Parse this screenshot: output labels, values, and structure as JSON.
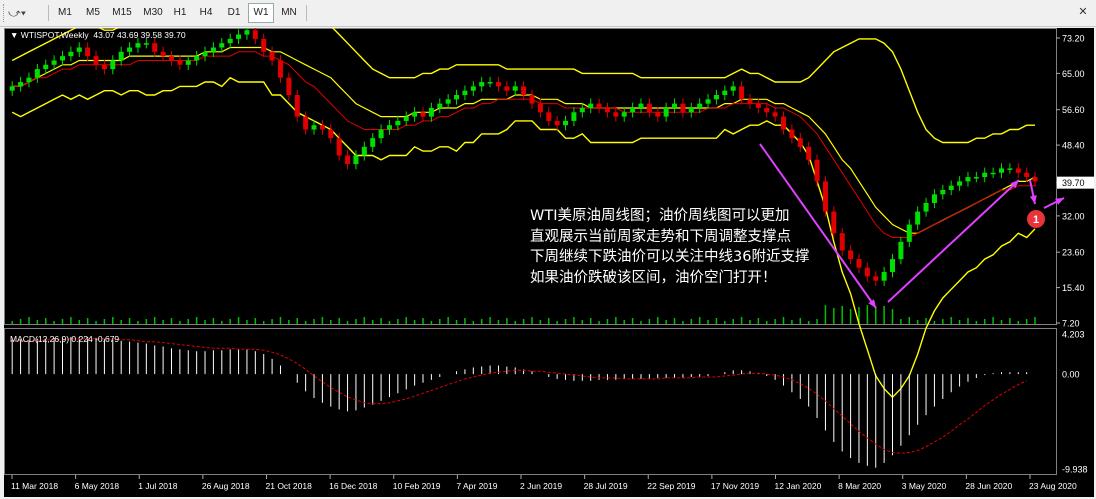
{
  "toolbar": {
    "timeframes": [
      "M1",
      "M5",
      "M15",
      "M30",
      "H1",
      "H4",
      "D1",
      "W1",
      "MN"
    ],
    "active": "W1",
    "close_icon": "close-icon",
    "tools_icon": "line-tools-icon"
  },
  "header": {
    "symbol": "WTISPOT,Weekly",
    "ohlc": "43.07 43.69 39.58 39.70"
  },
  "macd_header": "MACD(12,26,9) 0.224 -0.679",
  "annotation": {
    "lines": [
      "WTI美原油周线图；油价周线图可以更加",
      "直观展示当前周家走势和下周调整支撑点",
      "下周继续下跌油价可以关注中线36附近支撑",
      "如果油价跌破该区间，油价空门打开！"
    ],
    "badge": "1"
  },
  "colors": {
    "up": "#00e000",
    "down": "#e00000",
    "bollinger": "#ffff00",
    "ma": "#e00000",
    "macd_hist": "#ffffff",
    "macd_signal": "#e00000",
    "arrow": "#e040ff",
    "price_tag": "#ffffff"
  },
  "chart_data": [
    {
      "type": "candlestick",
      "title": "WTISPOT,Weekly",
      "y_ticks": [
        "73.20",
        "65.00",
        "56.60",
        "48.40",
        "39.70",
        "32.00",
        "23.60",
        "15.40",
        "7.20"
      ],
      "ylim": [
        7.2,
        73.2
      ],
      "current_price": "39.70",
      "x_ticks": [
        "11 Mar 2018",
        "6 May 2018",
        "1 Jul 2018",
        "26 Aug 2018",
        "21 Oct 2018",
        "16 Dec 2018",
        "10 Feb 2019",
        "7 Apr 2019",
        "2 Jun 2019",
        "28 Jul 2019",
        "22 Sep 2019",
        "17 Nov 2019",
        "12 Jan 2020",
        "8 Mar 2020",
        "3 May 2020",
        "28 Jun 2020",
        "23 Aug 2020"
      ],
      "close_series": [
        62,
        63,
        64,
        66,
        67,
        68,
        69,
        70,
        71,
        69,
        67,
        66,
        68,
        70,
        71,
        72,
        72,
        70,
        69,
        68,
        67,
        68,
        69,
        70,
        71,
        72,
        73,
        74,
        75,
        73,
        70,
        68,
        64,
        60,
        55,
        52,
        53,
        52,
        50,
        46,
        44,
        46,
        48,
        50,
        52,
        53,
        54,
        55,
        56,
        55,
        57,
        58,
        59,
        60,
        61,
        62,
        63,
        63,
        62,
        61,
        62,
        60,
        58,
        56,
        54,
        53,
        54,
        56,
        57,
        58,
        57,
        56,
        55,
        56,
        57,
        58,
        56,
        55,
        57,
        58,
        56,
        57,
        58,
        59,
        60,
        61,
        62,
        59,
        58,
        57,
        56,
        55,
        52,
        50,
        48,
        45,
        40,
        33,
        28,
        24,
        22,
        20,
        18,
        17,
        19,
        22,
        26,
        30,
        33,
        35,
        37,
        38,
        39,
        40,
        41,
        41,
        42,
        42,
        43,
        43,
        42,
        41,
        40
      ],
      "bb_upper": [
        68,
        69,
        70,
        71,
        72,
        73,
        74,
        75,
        76,
        77,
        76,
        75,
        75,
        76,
        77,
        77,
        78,
        78,
        77,
        77,
        76,
        76,
        76,
        77,
        77,
        78,
        78,
        79,
        79,
        79,
        79,
        80,
        80,
        80,
        80,
        79,
        78,
        77,
        76,
        74,
        72,
        70,
        68,
        66,
        65,
        64,
        64,
        64,
        64,
        65,
        65,
        66,
        66,
        67,
        67,
        67,
        67,
        67,
        67,
        66,
        66,
        66,
        66,
        66,
        66,
        66,
        66,
        66,
        65,
        65,
        65,
        65,
        65,
        65,
        65,
        64,
        64,
        64,
        64,
        64,
        64,
        64,
        64,
        64,
        64,
        64,
        65,
        66,
        65,
        65,
        64,
        63,
        63,
        63,
        63,
        64,
        66,
        68,
        70,
        71,
        72,
        73,
        73,
        73,
        72,
        70,
        66,
        61,
        56,
        52,
        50,
        49,
        49,
        49,
        49,
        50,
        50,
        51,
        51,
        52,
        52,
        53,
        53
      ],
      "bb_middle": [
        62,
        62,
        63,
        64,
        65,
        66,
        67,
        67,
        68,
        68,
        68,
        68,
        68,
        68,
        69,
        69,
        69,
        69,
        69,
        69,
        69,
        69,
        69,
        70,
        70,
        70,
        71,
        71,
        71,
        71,
        71,
        70,
        70,
        69,
        68,
        67,
        66,
        65,
        64,
        62,
        60,
        58,
        57,
        56,
        55,
        55,
        55,
        55,
        56,
        56,
        56,
        57,
        57,
        57,
        58,
        58,
        59,
        59,
        59,
        59,
        60,
        60,
        60,
        59,
        59,
        59,
        58,
        58,
        58,
        57,
        57,
        57,
        57,
        57,
        57,
        57,
        57,
        57,
        57,
        57,
        57,
        57,
        57,
        57,
        57,
        58,
        58,
        59,
        59,
        59,
        59,
        58,
        58,
        57,
        56,
        55,
        53,
        51,
        48,
        45,
        43,
        40,
        37,
        34,
        32,
        30,
        29,
        28,
        28,
        29,
        30,
        31,
        32,
        33,
        34,
        35,
        36,
        37,
        38,
        39,
        40,
        40,
        41
      ],
      "bb_lower": [
        56,
        55,
        56,
        57,
        58,
        59,
        60,
        59,
        60,
        59,
        60,
        61,
        61,
        60,
        61,
        61,
        60,
        60,
        61,
        61,
        62,
        62,
        62,
        63,
        63,
        62,
        64,
        63,
        63,
        63,
        63,
        60,
        60,
        58,
        56,
        55,
        54,
        53,
        52,
        50,
        48,
        46,
        46,
        46,
        45,
        46,
        46,
        46,
        48,
        47,
        47,
        48,
        48,
        47,
        49,
        49,
        51,
        51,
        51,
        52,
        54,
        54,
        54,
        52,
        52,
        52,
        50,
        50,
        51,
        49,
        49,
        49,
        49,
        49,
        49,
        50,
        50,
        50,
        50,
        50,
        50,
        50,
        50,
        50,
        50,
        52,
        51,
        52,
        53,
        53,
        54,
        53,
        53,
        51,
        49,
        46,
        40,
        34,
        26,
        19,
        14,
        7,
        1,
        -5,
        -8,
        -10,
        -8,
        -5,
        0,
        6,
        10,
        13,
        15,
        17,
        19,
        20,
        22,
        23,
        25,
        26,
        28,
        27,
        29
      ],
      "ma": [
        62,
        62,
        63,
        64,
        64,
        65,
        66,
        66,
        67,
        67,
        67,
        67,
        67,
        67,
        67,
        68,
        68,
        68,
        68,
        68,
        68,
        68,
        68,
        69,
        69,
        69,
        69,
        70,
        70,
        70,
        69,
        69,
        68,
        67,
        65,
        63,
        62,
        60,
        58,
        56,
        54,
        53,
        52,
        52,
        52,
        52,
        52,
        53,
        53,
        54,
        54,
        55,
        55,
        56,
        57,
        57,
        58,
        58,
        59,
        59,
        59,
        59,
        59,
        58,
        58,
        58,
        57,
        57,
        57,
        57,
        57,
        57,
        57,
        56,
        56,
        56,
        56,
        56,
        56,
        56,
        56,
        56,
        56,
        57,
        57,
        57,
        58,
        58,
        58,
        58,
        58,
        57,
        57,
        56,
        55,
        53,
        51,
        48,
        45,
        42,
        39,
        36,
        33,
        30,
        28,
        27,
        27,
        27,
        28,
        29,
        30,
        31,
        32,
        33,
        34,
        35,
        36,
        37,
        38,
        38,
        39,
        39,
        39
      ],
      "volume_note": "volume bars drawn along bottom"
    },
    {
      "type": "bar",
      "title": "MACD(12,26,9)",
      "y_ticks": [
        "4.203",
        "0.00",
        "-9.938"
      ],
      "ylim": [
        -9.938,
        4.203
      ],
      "main_value": 0.224,
      "signal_value": -0.679,
      "histogram": [
        3.6,
        3.6,
        3.6,
        3.7,
        3.7,
        3.8,
        3.8,
        3.9,
        3.9,
        3.9,
        3.8,
        3.7,
        3.6,
        3.5,
        3.4,
        3.3,
        3.2,
        3.0,
        2.9,
        2.7,
        2.6,
        2.5,
        2.4,
        2.4,
        2.5,
        2.5,
        2.6,
        2.6,
        2.6,
        2.4,
        2.1,
        1.6,
        0.9,
        0.0,
        -0.9,
        -1.8,
        -2.5,
        -3.0,
        -3.4,
        -3.7,
        -3.9,
        -3.8,
        -3.5,
        -3.2,
        -2.8,
        -2.4,
        -2.0,
        -1.6,
        -1.2,
        -0.9,
        -0.6,
        -0.3,
        0.0,
        0.3,
        0.5,
        0.7,
        0.8,
        0.9,
        0.9,
        0.8,
        0.7,
        0.5,
        0.3,
        0.0,
        -0.3,
        -0.5,
        -0.6,
        -0.7,
        -0.7,
        -0.7,
        -0.6,
        -0.6,
        -0.6,
        -0.5,
        -0.5,
        -0.5,
        -0.5,
        -0.4,
        -0.4,
        -0.4,
        -0.4,
        -0.3,
        -0.3,
        -0.2,
        0.0,
        0.2,
        0.4,
        0.4,
        0.3,
        0.1,
        -0.2,
        -0.6,
        -1.2,
        -1.9,
        -2.6,
        -3.4,
        -4.6,
        -5.9,
        -7.1,
        -8.1,
        -8.8,
        -9.3,
        -9.6,
        -9.8,
        -9.3,
        -8.5,
        -7.5,
        -6.4,
        -5.3,
        -4.3,
        -3.4,
        -2.6,
        -1.9,
        -1.3,
        -0.8,
        -0.4,
        -0.1,
        0.1,
        0.2,
        0.2,
        0.2,
        0.2
      ],
      "signal": [
        3.5,
        3.5,
        3.5,
        3.5,
        3.6,
        3.6,
        3.6,
        3.7,
        3.7,
        3.7,
        3.7,
        3.7,
        3.7,
        3.6,
        3.6,
        3.5,
        3.4,
        3.4,
        3.3,
        3.2,
        3.1,
        3.0,
        2.9,
        2.8,
        2.7,
        2.7,
        2.7,
        2.6,
        2.6,
        2.6,
        2.5,
        2.3,
        2.0,
        1.6,
        1.1,
        0.5,
        -0.2,
        -0.8,
        -1.4,
        -1.9,
        -2.4,
        -2.7,
        -3.0,
        -3.1,
        -3.1,
        -3.0,
        -2.8,
        -2.6,
        -2.3,
        -2.0,
        -1.7,
        -1.4,
        -1.1,
        -0.8,
        -0.5,
        -0.3,
        -0.1,
        0.1,
        0.2,
        0.3,
        0.4,
        0.4,
        0.3,
        0.3,
        0.2,
        0.1,
        0.0,
        -0.1,
        -0.2,
        -0.3,
        -0.4,
        -0.4,
        -0.4,
        -0.5,
        -0.5,
        -0.5,
        -0.5,
        -0.5,
        -0.4,
        -0.4,
        -0.4,
        -0.4,
        -0.3,
        -0.3,
        -0.3,
        -0.2,
        -0.1,
        0.0,
        0.1,
        0.1,
        0.0,
        -0.1,
        -0.3,
        -0.6,
        -1.0,
        -1.5,
        -2.1,
        -2.8,
        -3.6,
        -4.4,
        -5.2,
        -6.0,
        -6.7,
        -7.3,
        -7.9,
        -8.2,
        -8.3,
        -8.2,
        -8.0,
        -7.6,
        -7.1,
        -6.6,
        -6.0,
        -5.3,
        -4.7,
        -4.0,
        -3.3,
        -2.7,
        -2.1,
        -1.6,
        -1.1,
        -0.7
      ]
    }
  ]
}
